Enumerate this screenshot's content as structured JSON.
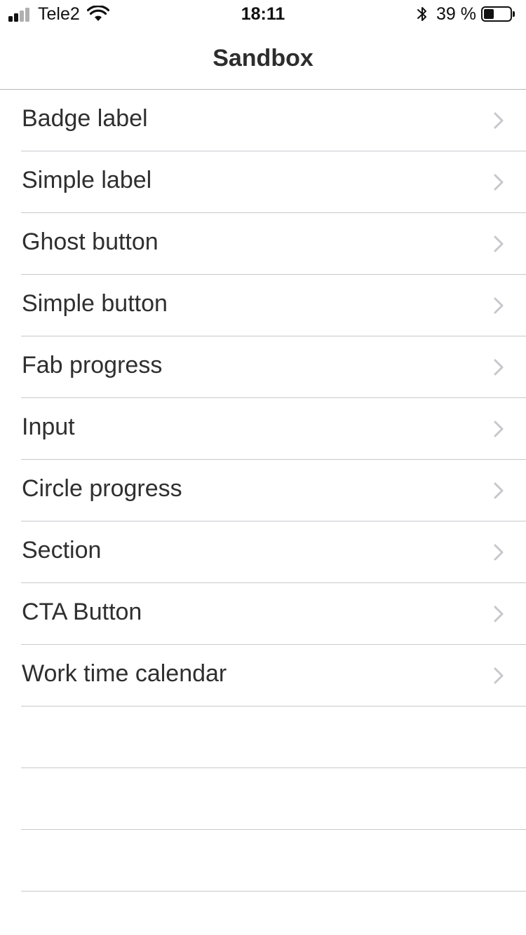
{
  "status_bar": {
    "carrier": "Tele2",
    "time": "18:11",
    "battery_percent": "39 %",
    "battery_level": 0.39,
    "signal_bars_filled": 2,
    "signal_bars_total": 4,
    "icons": [
      "signal-icon",
      "wifi-icon",
      "bluetooth-icon",
      "battery-icon"
    ]
  },
  "nav": {
    "title": "Sandbox"
  },
  "list": {
    "items": [
      {
        "label": "Badge label"
      },
      {
        "label": "Simple label"
      },
      {
        "label": "Ghost button"
      },
      {
        "label": "Simple button"
      },
      {
        "label": "Fab progress"
      },
      {
        "label": "Input"
      },
      {
        "label": "Circle progress"
      },
      {
        "label": "Section"
      },
      {
        "label": "CTA Button"
      },
      {
        "label": "Work time calendar"
      }
    ],
    "chevron_icon": "chevron-right-icon"
  },
  "colors": {
    "text": "#2f2f2f",
    "chevron": "#c7c7cc",
    "separator": "#c8c7cc",
    "background": "#ffffff"
  }
}
